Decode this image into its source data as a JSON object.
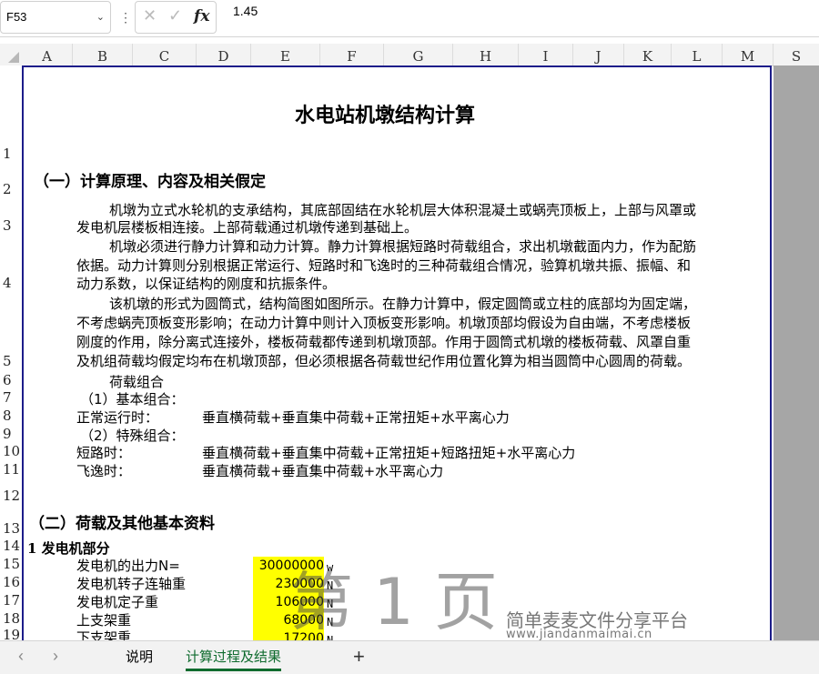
{
  "formula_bar": {
    "cell_ref": "F53",
    "value": "1.45"
  },
  "columns": [
    "A",
    "B",
    "C",
    "D",
    "E",
    "F",
    "G",
    "H",
    "I",
    "J",
    "K",
    "L",
    "M",
    "S"
  ],
  "rows": [
    "1",
    "2",
    "3",
    "4",
    "5",
    "6",
    "7",
    "8",
    "9",
    "10",
    "11",
    "12",
    "13",
    "14",
    "15",
    "16",
    "17",
    "18",
    "19"
  ],
  "doc": {
    "title": "水电站机墩结构计算",
    "sec1": "（一）计算原理、内容及相关假定",
    "p1_l1": "机墩为立式水轮机的支承结构，其底部固结在水轮机层大体积混凝土或蜗壳顶板上，上部与风罩或",
    "p1_l2": "发电机层楼板相连接。上部荷载通过机墩传递到基础上。",
    "p2_l1": "机墩必须进行静力计算和动力计算。静力计算根据短路时荷载组合，求出机墩截面内力，作为配筋",
    "p2_l2": "依据。动力计算则分别根据正常运行、短路时和飞逸时的三种荷载组合情况，验算机墩共振、振幅、和",
    "p2_l3": "动力系数，以保证结构的刚度和抗振条件。",
    "p3_l1": "该机墩的形式为圆筒式，结构简图如图所示。在静力计算中，假定圆筒或立柱的底部均为固定端，",
    "p3_l2": "不考虑蜗壳顶板变形影响；在动力计算中则计入顶板变形影响。机墩顶部均假设为自由端，不考虑楼板",
    "p3_l3": "刚度的作用，除分离式连接外，楼板荷载都传递到机墩顶部。作用于圆筒式机墩的楼板荷载、风罩自重",
    "p3_l4": "及机组荷载均假定均布在机墩顶部，但必须根据各荷载世纪作用位置化算为相当圆筒中心圆周的荷载。",
    "load_combo": "荷载组合",
    "basic": "（1）基本组合：",
    "normal_label": "正常运行时：",
    "normal_val": "垂直横荷载+垂直集中荷载+正常扭矩+水平离心力",
    "special": "（2）特殊组合：",
    "short_label": "短路时：",
    "short_val": "垂直横荷载+垂直集中荷载+正常扭矩+短路扭矩+水平离心力",
    "runaway_label": "飞逸时：",
    "runaway_val": "垂直横荷载+垂直集中荷载+水平离心力",
    "sec2": "（二）荷载及其他基本资料",
    "sub1": "1 发电机部分",
    "items": [
      {
        "label": "发电机的出力N=",
        "value": "30000000",
        "unit": "w"
      },
      {
        "label": "发电机转子连轴重",
        "value": "230000",
        "unit": "N"
      },
      {
        "label": "发电机定子重",
        "value": "106000",
        "unit": "N"
      },
      {
        "label": "上支架重",
        "value": "68000",
        "unit": "N"
      },
      {
        "label": "下支架重",
        "value": "17200",
        "unit": "N"
      }
    ]
  },
  "watermark": {
    "page": "第 1 页",
    "site_name": "简单麦麦文件分享平台",
    "site_url": "www.jiandanmaimai.cn"
  },
  "tabs": {
    "items": [
      "说明",
      "计算过程及结果"
    ],
    "active_index": 1,
    "add_label": "+",
    "prev": "‹",
    "next": "›"
  }
}
